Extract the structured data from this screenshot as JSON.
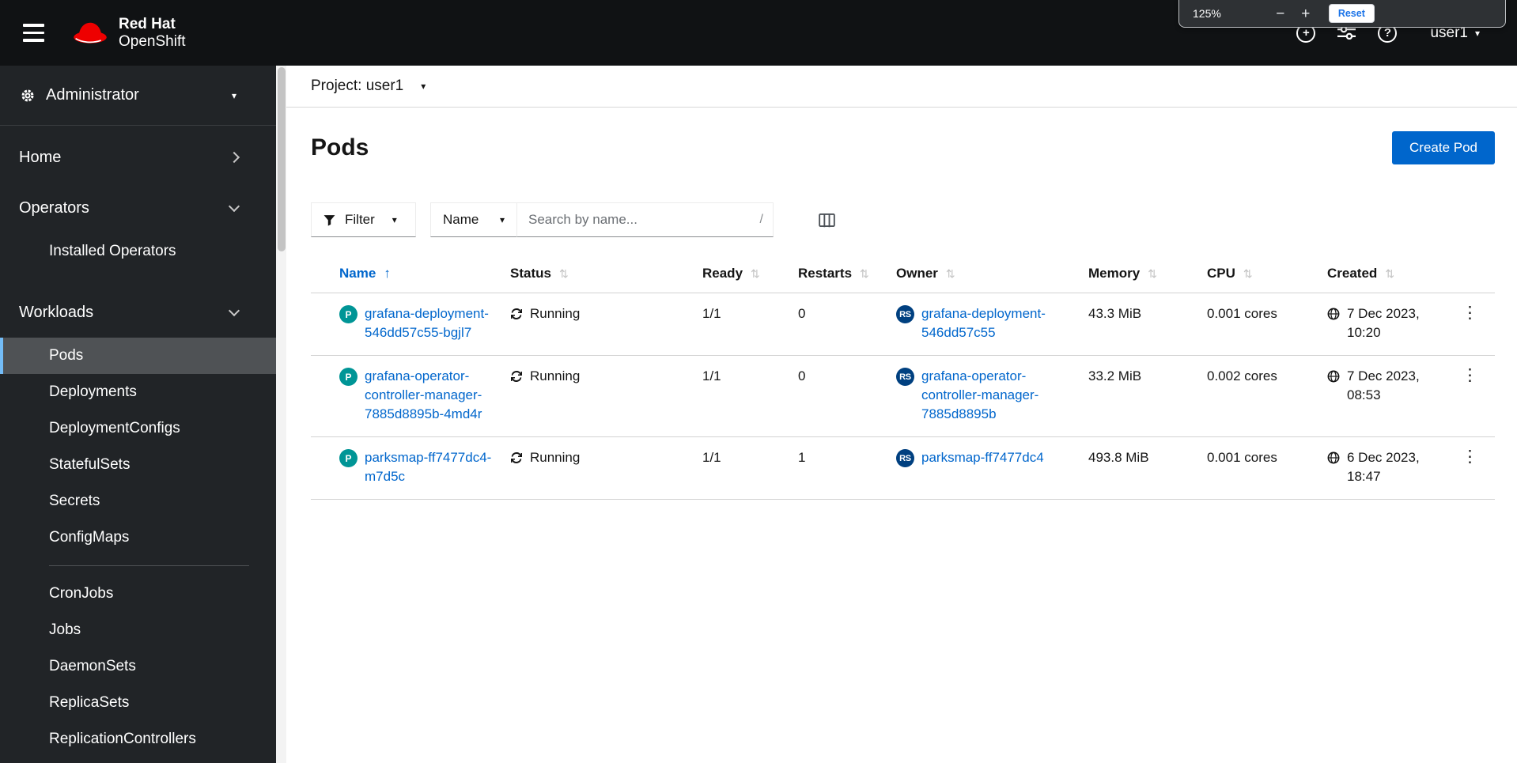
{
  "browser_zoom_popup": {
    "level": "125%",
    "zoom_out": "−",
    "zoom_in": "+",
    "reset_label": "Reset"
  },
  "masthead": {
    "brand_line1": "Red Hat",
    "brand_line2": "OpenShift",
    "username": "user1"
  },
  "icons": {
    "caret_down": "▾",
    "kebab": "⋮",
    "sort_active": "↑",
    "sort_inactive": "⇅",
    "search_shortcut": "/",
    "help": "?",
    "quick_add": "+"
  },
  "sidebar": {
    "perspective": "Administrator",
    "selected_item": "Pods",
    "items": {
      "home": "Home",
      "operators": "Operators",
      "installed_operators": "Installed Operators",
      "workloads": "Workloads",
      "pods": "Pods",
      "deployments": "Deployments",
      "deploymentconfigs": "DeploymentConfigs",
      "statefulsets": "StatefulSets",
      "secrets": "Secrets",
      "configmaps": "ConfigMaps",
      "cronjobs": "CronJobs",
      "jobs": "Jobs",
      "daemonsets": "DaemonSets",
      "replicasets": "ReplicaSets",
      "replicationcontrollers": "ReplicationControllers"
    }
  },
  "project_bar": {
    "label": "Project: user1"
  },
  "page": {
    "title": "Pods",
    "create_button_label": "Create Pod"
  },
  "toolbar": {
    "filter_label": "Filter",
    "attribute_label": "Name",
    "search_placeholder": "Search by name..."
  },
  "table": {
    "sorted_by": "Name",
    "columns": [
      {
        "label": "Name"
      },
      {
        "label": "Status"
      },
      {
        "label": "Ready"
      },
      {
        "label": "Restarts"
      },
      {
        "label": "Owner"
      },
      {
        "label": "Memory"
      },
      {
        "label": "CPU"
      },
      {
        "label": "Created"
      }
    ],
    "rows": [
      {
        "badge": "P",
        "name": "grafana-deployment-546dd57c55-bgjl7",
        "status": "Running",
        "ready": "1/1",
        "restarts": "0",
        "owner_badge": "RS",
        "owner": "grafana-deployment-546dd57c55",
        "memory": "43.3 MiB",
        "cpu": "0.001 cores",
        "created": "7 Dec 2023, 10:20"
      },
      {
        "badge": "P",
        "name": "grafana-operator-controller-manager-7885d8895b-4md4r",
        "status": "Running",
        "ready": "1/1",
        "restarts": "0",
        "owner_badge": "RS",
        "owner": "grafana-operator-controller-manager-7885d8895b",
        "memory": "33.2 MiB",
        "cpu": "0.002 cores",
        "created": "7 Dec 2023, 08:53"
      },
      {
        "badge": "P",
        "name": "parksmap-ff7477dc4-m7d5c",
        "status": "Running",
        "ready": "1/1",
        "restarts": "1",
        "owner_badge": "RS",
        "owner": "parksmap-ff7477dc4",
        "memory": "493.8 MiB",
        "cpu": "0.001 cores",
        "created": "6 Dec 2023, 18:47"
      }
    ]
  },
  "colors": {
    "accent": "#0066cc",
    "pod_badge": "#009596",
    "replicaset_badge": "#004080",
    "nav_current_accent": "#73bcf7",
    "create_button": "#0066cc"
  }
}
